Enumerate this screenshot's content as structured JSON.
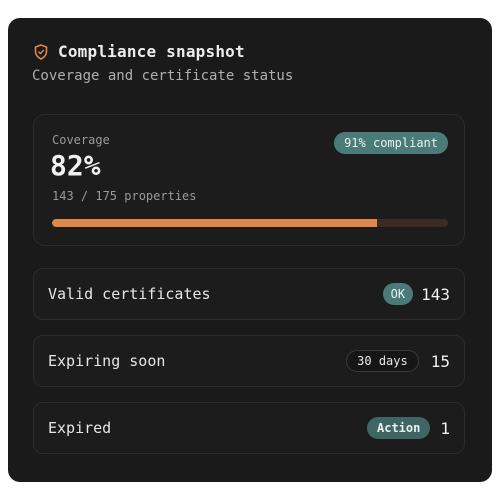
{
  "header": {
    "title": "Compliance snapshot",
    "subtitle": "Coverage and certificate status",
    "icon": "shield-icon"
  },
  "coverage": {
    "label": "Coverage",
    "value": "82%",
    "detail": "143 / 175 properties",
    "badge": "91% compliant",
    "progress_fraction": 0.82
  },
  "rows": [
    {
      "label": "Valid certificates",
      "badge": "OK",
      "count": "143"
    },
    {
      "label": "Expiring soon",
      "badge": "30 days",
      "count": "15"
    },
    {
      "label": "Expired",
      "badge": "Action",
      "count": "1"
    }
  ],
  "colors": {
    "accent": "#e0884a",
    "teal": "#4b7b78",
    "card_bg": "#1a1a1a"
  }
}
